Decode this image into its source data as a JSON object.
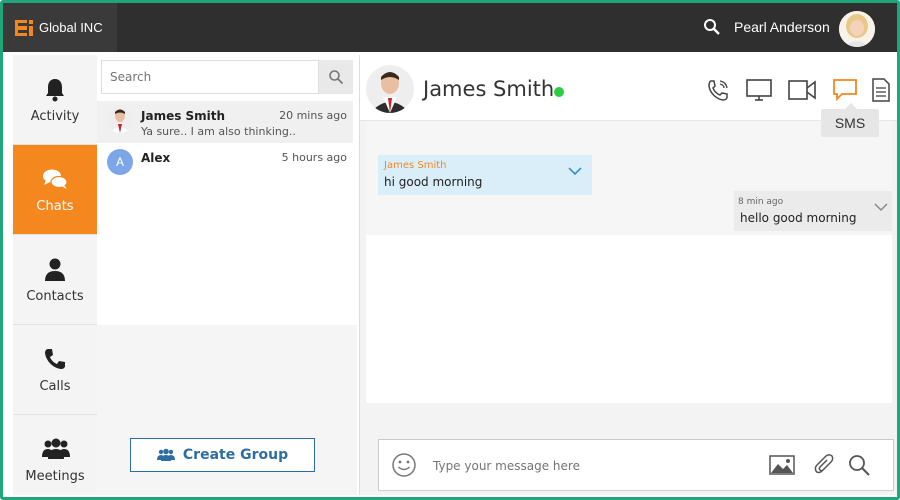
{
  "app": {
    "brand": "Global INC",
    "user_name": "Pearl Anderson"
  },
  "nav": {
    "items": [
      {
        "label": "Activity",
        "icon": "bell-icon"
      },
      {
        "label": "Chats",
        "icon": "chat-bubbles-icon"
      },
      {
        "label": "Contacts",
        "icon": "person-icon"
      },
      {
        "label": "Calls",
        "icon": "phone-icon"
      },
      {
        "label": "Meetings",
        "icon": "group-icon"
      }
    ],
    "active": "Chats"
  },
  "search": {
    "placeholder": "Search"
  },
  "chats": [
    {
      "name": "James Smith",
      "preview": "Ya sure.. I am also thinking..",
      "time": "20 mins ago"
    },
    {
      "name": "Alex",
      "initial": "A",
      "preview": "",
      "time": "5 hours ago"
    }
  ],
  "create_group_label": "Create Group",
  "conversation": {
    "contact_name": "James Smith",
    "status_color": "#2ecc40",
    "tooltip": "SMS",
    "messages": [
      {
        "sender": "James Smith",
        "text": "hi good morning"
      },
      {
        "time": "8 min ago",
        "text": "hello good morning"
      }
    ],
    "composer_placeholder": "Type your message here"
  },
  "colors": {
    "accent": "#f5871f",
    "frame": "#1fa67a",
    "topbar": "#2f2f2f",
    "link": "#2e6da4"
  }
}
